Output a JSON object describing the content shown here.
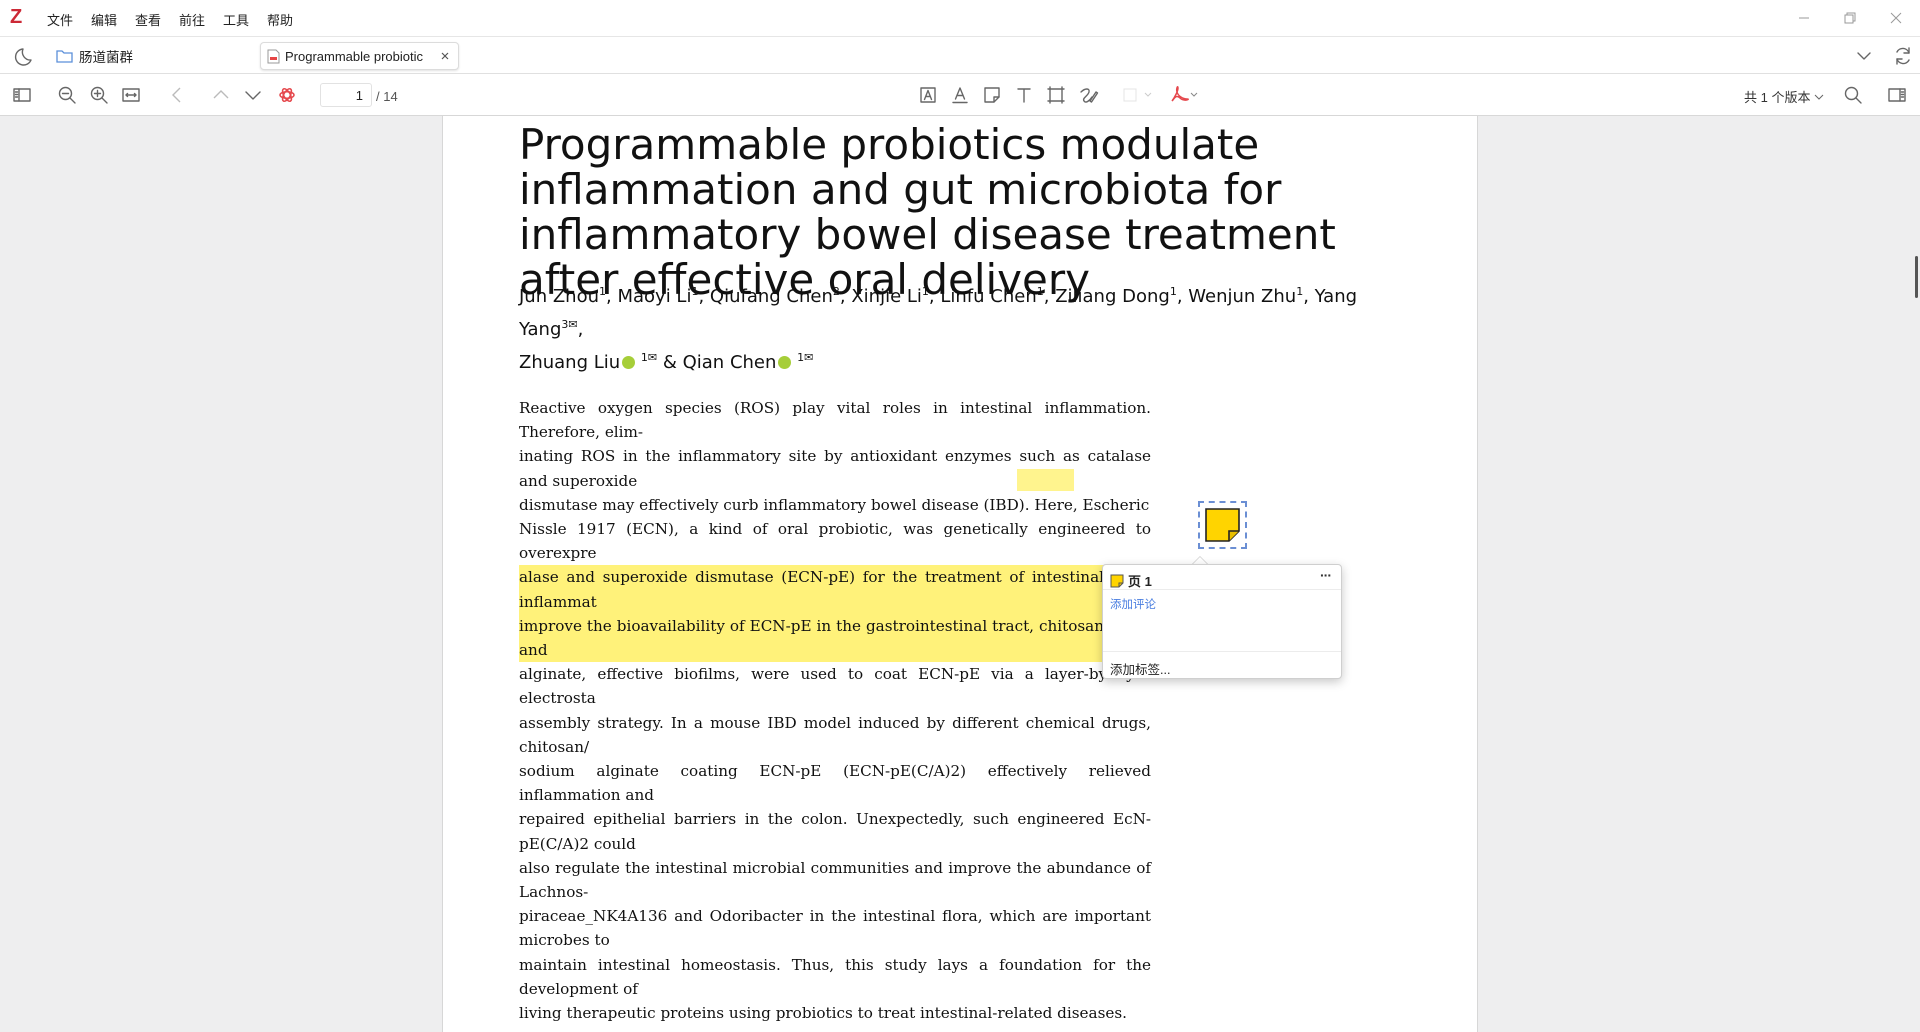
{
  "app": {
    "logo": "Z",
    "menus": [
      "文件",
      "编辑",
      "查看",
      "前往",
      "工具",
      "帮助"
    ]
  },
  "tabs": {
    "library_label": "肠道菌群",
    "document_tab": "Programmable probiotic"
  },
  "toolbar": {
    "page_current": "1",
    "page_total": "/ 14",
    "versions_label": "共 1 个版本"
  },
  "document": {
    "title": "Programmable probiotics modulate inflammation and gut microbiota for inflammatory bowel disease treatment after effective oral delivery",
    "authors": [
      {
        "name": "Jun Zhou",
        "sup": "1"
      },
      {
        "name": "Maoyi Li",
        "sup": "1"
      },
      {
        "name": "Qiufang Chen",
        "sup": "2"
      },
      {
        "name": "Xinjie Li",
        "sup": "1"
      },
      {
        "name": "Linfu Chen",
        "sup": "1"
      },
      {
        "name": "Ziliang Dong",
        "sup": "1"
      },
      {
        "name": "Wenjun Zhu",
        "sup": "1"
      },
      {
        "name": "Yang Yang",
        "sup": "3✉"
      },
      {
        "name": "Zhuang Liu",
        "sup": "1✉"
      },
      {
        "name": "Qian Chen",
        "sup": "1✉"
      }
    ],
    "abstract_lines": [
      "Reactive oxygen species (ROS) play vital roles in intestinal inflammation. Therefore, elim-",
      "inating ROS in the inflammatory site by antioxidant enzymes such as catalase and superoxide",
      "dismutase may effectively curb inflammatory bowel disease (IBD). Here, Escheric",
      "Nissle 1917 (ECN), a kind of oral probiotic, was genetically engineered to overexpre",
      "alase and superoxide dismutase (ECN-pE) for the treatment of intestinal inflammat",
      "improve the bioavailability of ECN-pE in the gastrointestinal tract, chitosan and",
      "alginate, effective biofilms, were used to coat ECN-pE via a layer-by-layer electrosta",
      "assembly strategy. In a mouse IBD model induced by different chemical drugs, chitosan/",
      "sodium alginate coating ECN-pE (ECN-pE(C/A)2) effectively relieved inflammation and",
      "repaired epithelial barriers in the colon. Unexpectedly, such engineered EcN-pE(C/A)2 could",
      "also regulate the intestinal microbial communities and improve the abundance of Lachnos-",
      "piraceae_NK4A136 and Odoribacter in the intestinal flora, which are important microbes to",
      "maintain intestinal homeostasis. Thus, this study lays a foundation for the development of",
      "living therapeutic proteins using probiotics to treat intestinal-related diseases."
    ]
  },
  "annotation_popup": {
    "page_label": "页 1",
    "add_comment": "添加评论",
    "add_tags": "添加标签...",
    "more": "···"
  },
  "colors": {
    "highlight": "#fff27a",
    "note_yellow": "#ffd400",
    "link_blue": "#4a7ee0",
    "logo_red": "#cc2936"
  }
}
